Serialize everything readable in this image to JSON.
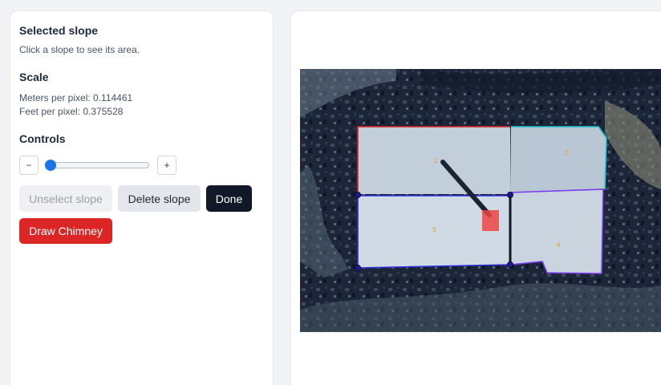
{
  "selected_slope": {
    "title": "Selected slope",
    "hint": "Click a slope to see its area."
  },
  "scale": {
    "title": "Scale",
    "meters_label": "Meters per pixel: 0.114461",
    "feet_label": "Feet per pixel: 0.375528"
  },
  "controls": {
    "title": "Controls",
    "decrement_label": "−",
    "increment_label": "+",
    "slider_value": 0.0,
    "unselect_label": "Unselect slope",
    "delete_label": "Delete slope",
    "done_label": "Done",
    "chimney_label": "Draw Chimney"
  },
  "roof_map": {
    "slopes": [
      {
        "label": "1",
        "outline_color": "#dc2626"
      },
      {
        "label": "2",
        "outline_color": "#22c3d6"
      },
      {
        "label": "3",
        "outline_color": "#2d2cd6"
      },
      {
        "label": "4",
        "outline_color": "#7c3aed"
      }
    ],
    "chimney_color": "#ef4444",
    "vertex_color": "#1e1b8f"
  }
}
